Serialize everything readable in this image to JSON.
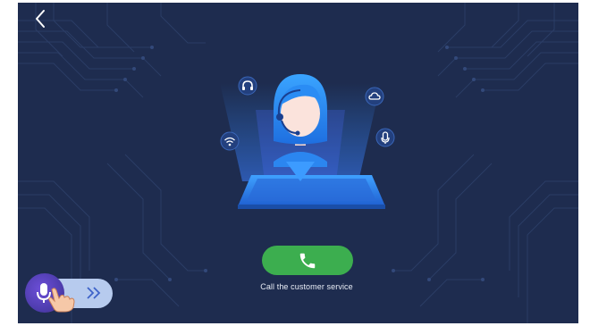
{
  "call": {
    "label": "Call the customer service"
  },
  "icons": {
    "back": "chevron-left-icon",
    "phone": "phone-icon",
    "headset": "headphones-icon",
    "cloud": "cloud-icon",
    "wifi": "wifi-icon",
    "mic": "microphone-icon",
    "slider_arrows": "double-chevron-right-icon",
    "hand": "hand-pointer-icon"
  },
  "colors": {
    "background": "#1e2c4f",
    "call_button": "#3cae4f",
    "accent_blue": "#2f8fff",
    "slider_track": "#b7cbee"
  }
}
